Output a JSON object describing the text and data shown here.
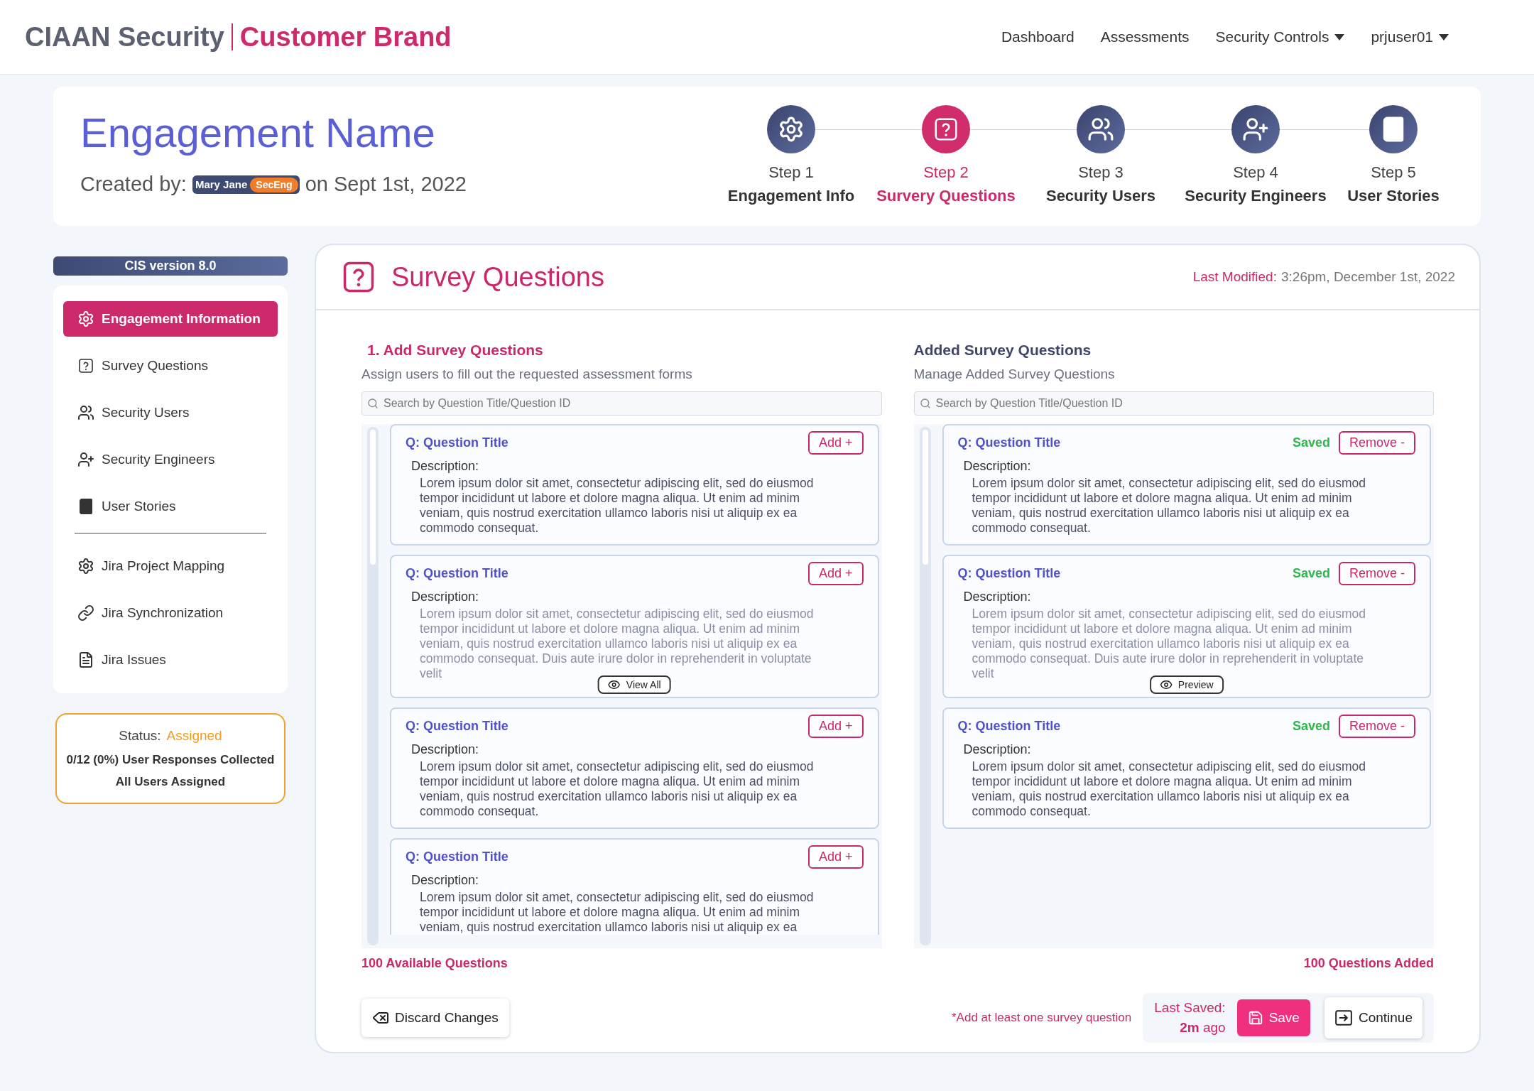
{
  "header": {
    "brand": "CIAAN Security",
    "sub_brand": "Customer Brand",
    "nav": [
      {
        "label": "Dashboard",
        "dropdown": false
      },
      {
        "label": "Assessments",
        "dropdown": false
      },
      {
        "label": "Security Controls",
        "dropdown": true
      },
      {
        "label": "prjuser01",
        "dropdown": true
      }
    ]
  },
  "engagement": {
    "title": "Engagement Name",
    "created_prefix": "Created by:",
    "user": "Mary Jane",
    "role": "SecEng",
    "created_suffix": "on Sept 1st, 2022"
  },
  "steps": [
    {
      "step": "Step 1",
      "label": "Engagement Info",
      "selected": false
    },
    {
      "step": "Step 2",
      "label": "Survery Questions",
      "selected": true
    },
    {
      "step": "Step 3",
      "label": "Security Users",
      "selected": false
    },
    {
      "step": "Step 4",
      "label": "Security Engineers",
      "selected": false
    },
    {
      "step": "Step 5",
      "label": "User Stories",
      "selected": false
    }
  ],
  "sidebar": {
    "version": "CIS version 8.0",
    "items": [
      {
        "label": "Engagement Information",
        "selected": true
      },
      {
        "label": "Survey Questions",
        "selected": false
      },
      {
        "label": "Security Users",
        "selected": false
      },
      {
        "label": "Security Engineers",
        "selected": false
      },
      {
        "label": "User Stories",
        "selected": false
      }
    ],
    "jira_items": [
      {
        "label": "Jira Project Mapping",
        "selected": false
      },
      {
        "label": "Jira Synchronization",
        "selected": false
      },
      {
        "label": "Jira Issues",
        "selected": false
      }
    ]
  },
  "status": {
    "label": "Status:",
    "value": "Assigned",
    "responses": "0/12 (0%) User Responses Collected",
    "assigned": "All Users Assigned"
  },
  "panel": {
    "title": "Survey Questions",
    "last_modified_label": "Last Modified:",
    "last_modified": "3:26pm, December 1st, 2022"
  },
  "available": {
    "heading": "1. Add Survey Questions",
    "subheading": "Assign users to fill out the requested assessment forms",
    "search_placeholder": "Search by Question Title/Question ID",
    "count": "100 Available Questions",
    "questions": [
      {
        "kind": "full",
        "title": "Q: Question Title",
        "action": "Add +",
        "description_label": "Description:",
        "description": "Lorem ipsum dolor sit amet, consectetur adipiscing elit, sed do eiusmod tempor incididunt ut labore et dolore magna aliqua. Ut enim ad minim veniam, quis nostrud exercitation ullamco laboris nisi ut aliquip ex ea commodo consequat."
      },
      {
        "kind": "truncated",
        "title": "Q: Question Title",
        "action": "Add +",
        "description_label": "Description:",
        "description": "Lorem ipsum dolor sit amet, consectetur adipiscing elit, sed do eiusmod tempor incididunt ut labore et dolore magna aliqua. Ut enim ad minim veniam, quis nostrud exercitation ullamco laboris nisi ut aliquip ex ea commodo consequat. Duis aute irure dolor in reprehenderit in voluptate velit",
        "preview_button": "View All"
      },
      {
        "kind": "full",
        "title": "Q: Question Title",
        "action": "Add +",
        "description_label": "Description:",
        "description": "Lorem ipsum dolor sit amet, consectetur adipiscing elit, sed do eiusmod tempor incididunt ut labore et dolore magna aliqua. Ut enim ad minim veniam, quis nostrud exercitation ullamco laboris nisi ut aliquip ex ea commodo consequat."
      },
      {
        "kind": "cut",
        "title": "Q: Question Title",
        "action": "Add +",
        "description_label": "Description:",
        "description": "Lorem ipsum dolor sit amet, consectetur adipiscing elit, sed do eiusmod tempor incididunt ut labore et dolore magna aliqua. Ut enim ad minim veniam, quis nostrud exercitation ullamco laboris nisi ut aliquip ex ea"
      }
    ]
  },
  "added": {
    "heading": "Added Survey Questions",
    "subheading": "Manage Added Survey Questions",
    "search_placeholder": "Search by Question Title/Question ID",
    "count": "100 Questions Added",
    "questions": [
      {
        "kind": "full",
        "title": "Q: Question Title",
        "status": "Saved",
        "action": "Remove -",
        "description_label": "Description:",
        "description": "Lorem ipsum dolor sit amet, consectetur adipiscing elit, sed do eiusmod tempor incididunt ut labore et dolore magna aliqua. Ut enim ad minim veniam, quis nostrud exercitation ullamco laboris nisi ut aliquip ex ea commodo consequat."
      },
      {
        "kind": "truncated",
        "title": "Q: Question Title",
        "status": "Saved",
        "action": "Remove -",
        "description_label": "Description:",
        "description": "Lorem ipsum dolor sit amet, consectetur adipiscing elit, sed do eiusmod tempor incididunt ut labore et dolore magna aliqua. Ut enim ad minim veniam, quis nostrud exercitation ullamco laboris nisi ut aliquip ex ea commodo consequat. Duis aute irure dolor in reprehenderit in voluptate velit",
        "preview_button": "Preview"
      },
      {
        "kind": "full",
        "title": "Q: Question Title",
        "status": "Saved",
        "action": "Remove -",
        "description_label": "Description:",
        "description": "Lorem ipsum dolor sit amet, consectetur adipiscing elit, sed do eiusmod tempor incididunt ut labore et dolore magna aliqua. Ut enim ad minim veniam, quis nostrud exercitation ullamco laboris nisi ut aliquip ex ea commodo consequat."
      }
    ]
  },
  "footer": {
    "discard": "Discard Changes",
    "hint": "*Add at least one survey question",
    "last_saved_label": "Last Saved:",
    "last_saved_value": "2m",
    "last_saved_suffix": "ago",
    "save": "Save",
    "continue": "Continue"
  }
}
